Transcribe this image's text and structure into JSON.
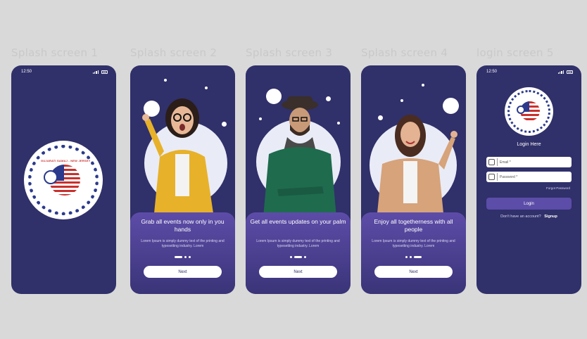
{
  "labels": [
    "Splash screen 1",
    "Splash screen 2",
    "Splash screen 3",
    "Splash screen 4",
    "login screen 5"
  ],
  "status_time": "12:50",
  "logo_text": "GUJARATI SAMAJ - NEW JERSEY",
  "onboarding": [
    {
      "title": "Grab all events now only in you hands",
      "desc": "Lorem Ipsum is simply dummy text of the printing and typesetting industry. Lorem",
      "next": "Next",
      "active_page": 0
    },
    {
      "title": "Get all events updates on your palm",
      "desc": "Lorem Ipsum is simply dummy text of the printing and typesetting industry. Lorem",
      "next": "Next",
      "active_page": 1
    },
    {
      "title": "Enjoy all togetherness with all people",
      "desc": "Lorem Ipsum is simply dummy text of the printing and typesetting industry. Lorem",
      "next": "Next",
      "active_page": 2
    }
  ],
  "login": {
    "title": "Login Here",
    "email_placeholder": "Email *",
    "password_placeholder": "Password *",
    "forgot": "Forgot Password",
    "button": "Login",
    "no_account": "Don't have an account?",
    "signup": "Signup"
  },
  "colors": {
    "phone_bg": "#30306a",
    "card_top": "#5d4ca8",
    "accent": "#5b4da8",
    "page_bg": "#d9d9d9"
  }
}
